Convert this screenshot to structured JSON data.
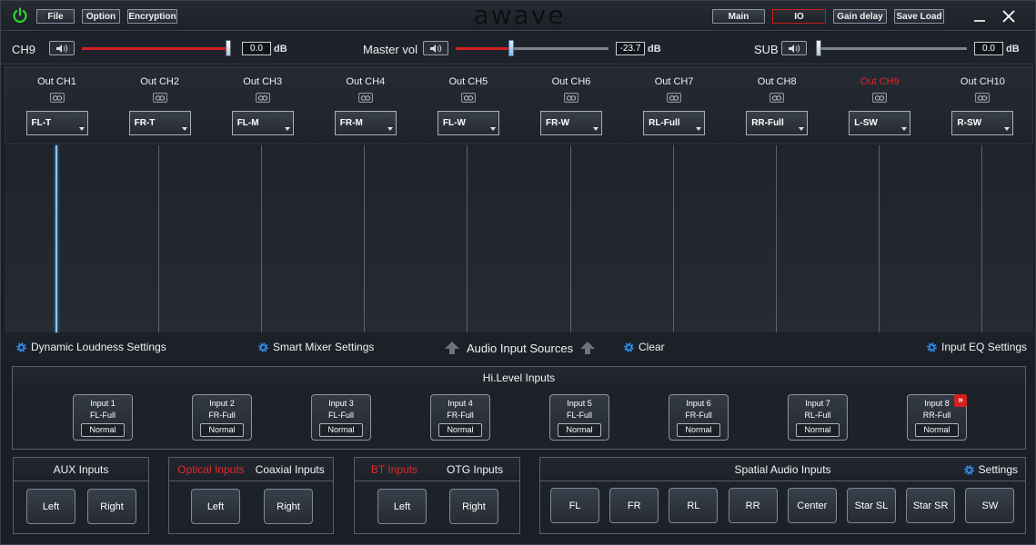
{
  "titlebar": {
    "file_label": "File",
    "option_label": "Option",
    "encryption_label": "Encryption",
    "logo_text": "awave",
    "main_label": "Main",
    "io_label": "IO",
    "gain_delay_label": "Gain delay",
    "save_load_label": "Save Load",
    "accent_color": "#cc2020",
    "power_color": "#2fd12f"
  },
  "volume": {
    "channel": {
      "label": "CH9",
      "value": "0.0",
      "unit": "dB",
      "level_fraction": 1.0
    },
    "master": {
      "label": "Master vol",
      "value": "-23.7",
      "unit": "dB",
      "level_fraction": 0.36
    },
    "sub": {
      "label": "SUB",
      "value": "0.0",
      "unit": "dB",
      "level_fraction": 0.0
    }
  },
  "outputs": [
    {
      "name": "Out CH1",
      "source": "FL-T",
      "selected": false
    },
    {
      "name": "Out CH2",
      "source": "FR-T",
      "selected": false
    },
    {
      "name": "Out CH3",
      "source": "FL-M",
      "selected": false
    },
    {
      "name": "Out CH4",
      "source": "FR-M",
      "selected": false
    },
    {
      "name": "Out CH5",
      "source": "FL-W",
      "selected": false
    },
    {
      "name": "Out CH6",
      "source": "FR-W",
      "selected": false
    },
    {
      "name": "Out CH7",
      "source": "RL-Full",
      "selected": false
    },
    {
      "name": "Out CH8",
      "source": "RR-Full",
      "selected": false
    },
    {
      "name": "Out CH9",
      "source": "L-SW",
      "selected": true
    },
    {
      "name": "Out CH10",
      "source": "R-SW",
      "selected": false
    }
  ],
  "toolbar": {
    "dynamic_loudness": "Dynamic Loudness Settings",
    "smart_mixer": "Smart Mixer Settings",
    "audio_input_sources": "Audio Input Sources",
    "clear": "Clear",
    "input_eq": "Input EQ Settings"
  },
  "hilevel": {
    "title": "Hi.Level Inputs",
    "inputs": [
      {
        "name": "Input 1",
        "channel": "FL-Full",
        "mode": "Normal"
      },
      {
        "name": "Input 2",
        "channel": "FR-Full",
        "mode": "Normal"
      },
      {
        "name": "Input 3",
        "channel": "FL-Full",
        "mode": "Normal"
      },
      {
        "name": "Input 4",
        "channel": "FR-Full",
        "mode": "Normal"
      },
      {
        "name": "Input 5",
        "channel": "FL-Full",
        "mode": "Normal"
      },
      {
        "name": "Input 6",
        "channel": "FR-Full",
        "mode": "Normal"
      },
      {
        "name": "Input 7",
        "channel": "RL-Full",
        "mode": "Normal"
      },
      {
        "name": "Input 8",
        "channel": "RR-Full",
        "mode": "Normal"
      }
    ]
  },
  "aux": {
    "title": "AUX Inputs",
    "left": "Left",
    "right": "Right"
  },
  "coaxial": {
    "alt_title": "Optical Inputs",
    "title": "Coaxial Inputs",
    "left": "Left",
    "right": "Right"
  },
  "otg": {
    "alt_title": "BT Inputs",
    "title": "OTG Inputs",
    "left": "Left",
    "right": "Right"
  },
  "spatial": {
    "title": "Spatial Audio Inputs",
    "settings": "Settings",
    "buttons": [
      "FL",
      "FR",
      "RL",
      "RR",
      "Center",
      "Star SL",
      "Star SR",
      "SW"
    ]
  }
}
